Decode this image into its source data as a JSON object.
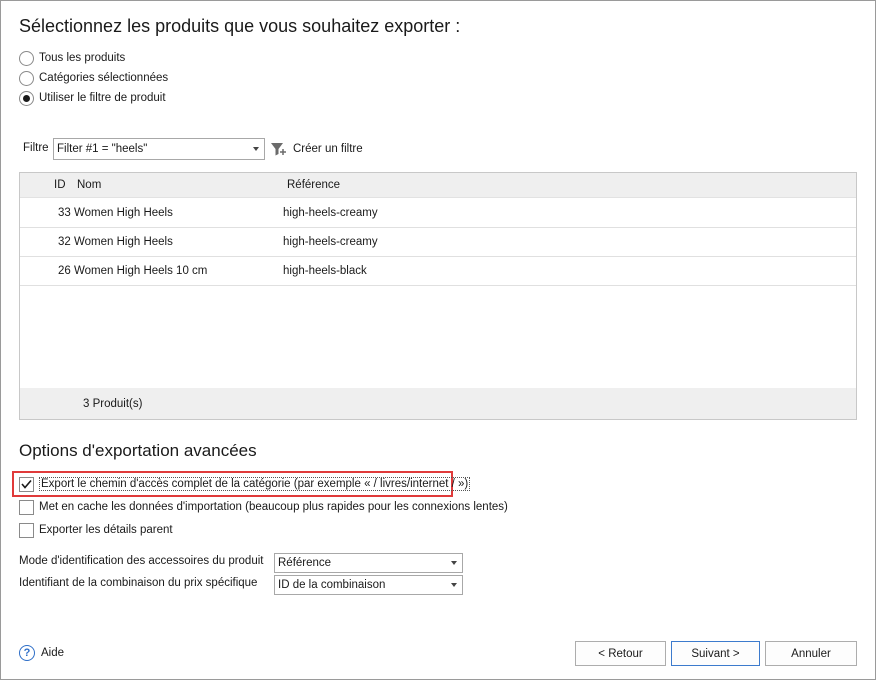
{
  "title": "Sélectionnez les produits que vous souhaitez exporter :",
  "scope": {
    "options": [
      {
        "label": "Tous les produits",
        "selected": false
      },
      {
        "label": "Catégories sélectionnées",
        "selected": false
      },
      {
        "label": "Utiliser le filtre de produit",
        "selected": true
      }
    ]
  },
  "filter": {
    "label": "Filtre",
    "value": "Filter #1 = \"heels\"",
    "create_label": "Créer un filtre",
    "create_icon": "filter-add-icon"
  },
  "grid": {
    "columns": [
      "ID",
      "Nom",
      "Référence"
    ],
    "rows": [
      {
        "id": "33",
        "name": "Women High Heels",
        "reference": "high-heels-creamy"
      },
      {
        "id": "32",
        "name": "Women High Heels",
        "reference": "high-heels-creamy"
      },
      {
        "id": "26",
        "name": "Women High Heels 10 cm",
        "reference": "high-heels-black"
      }
    ],
    "footer": "3 Produit(s)"
  },
  "advanced": {
    "title": "Options d'exportation avancées",
    "checkboxes": [
      {
        "label": "Export le chemin d'accès complet de la catégorie (par exemple « / livres/internet / »)",
        "checked": true
      },
      {
        "label": "Met en cache les données d'importation (beaucoup plus rapides pour les connexions lentes)",
        "checked": false
      },
      {
        "label": "Exporter les détails parent",
        "checked": false
      }
    ],
    "accessory_mode": {
      "label": "Mode d'identification des accessoires du produit",
      "value": "Référence"
    },
    "combination_id": {
      "label": "Identifiant de la combinaison du prix spécifique",
      "value": "ID de la combinaison"
    },
    "highlight_color": "#e03a3a"
  },
  "footer": {
    "help_label": "Aide",
    "back_label": "< Retour",
    "next_label": "Suivant >",
    "cancel_label": "Annuler"
  },
  "colors": {
    "accent": "#2f6fc8",
    "grid_header": "#efefef"
  }
}
